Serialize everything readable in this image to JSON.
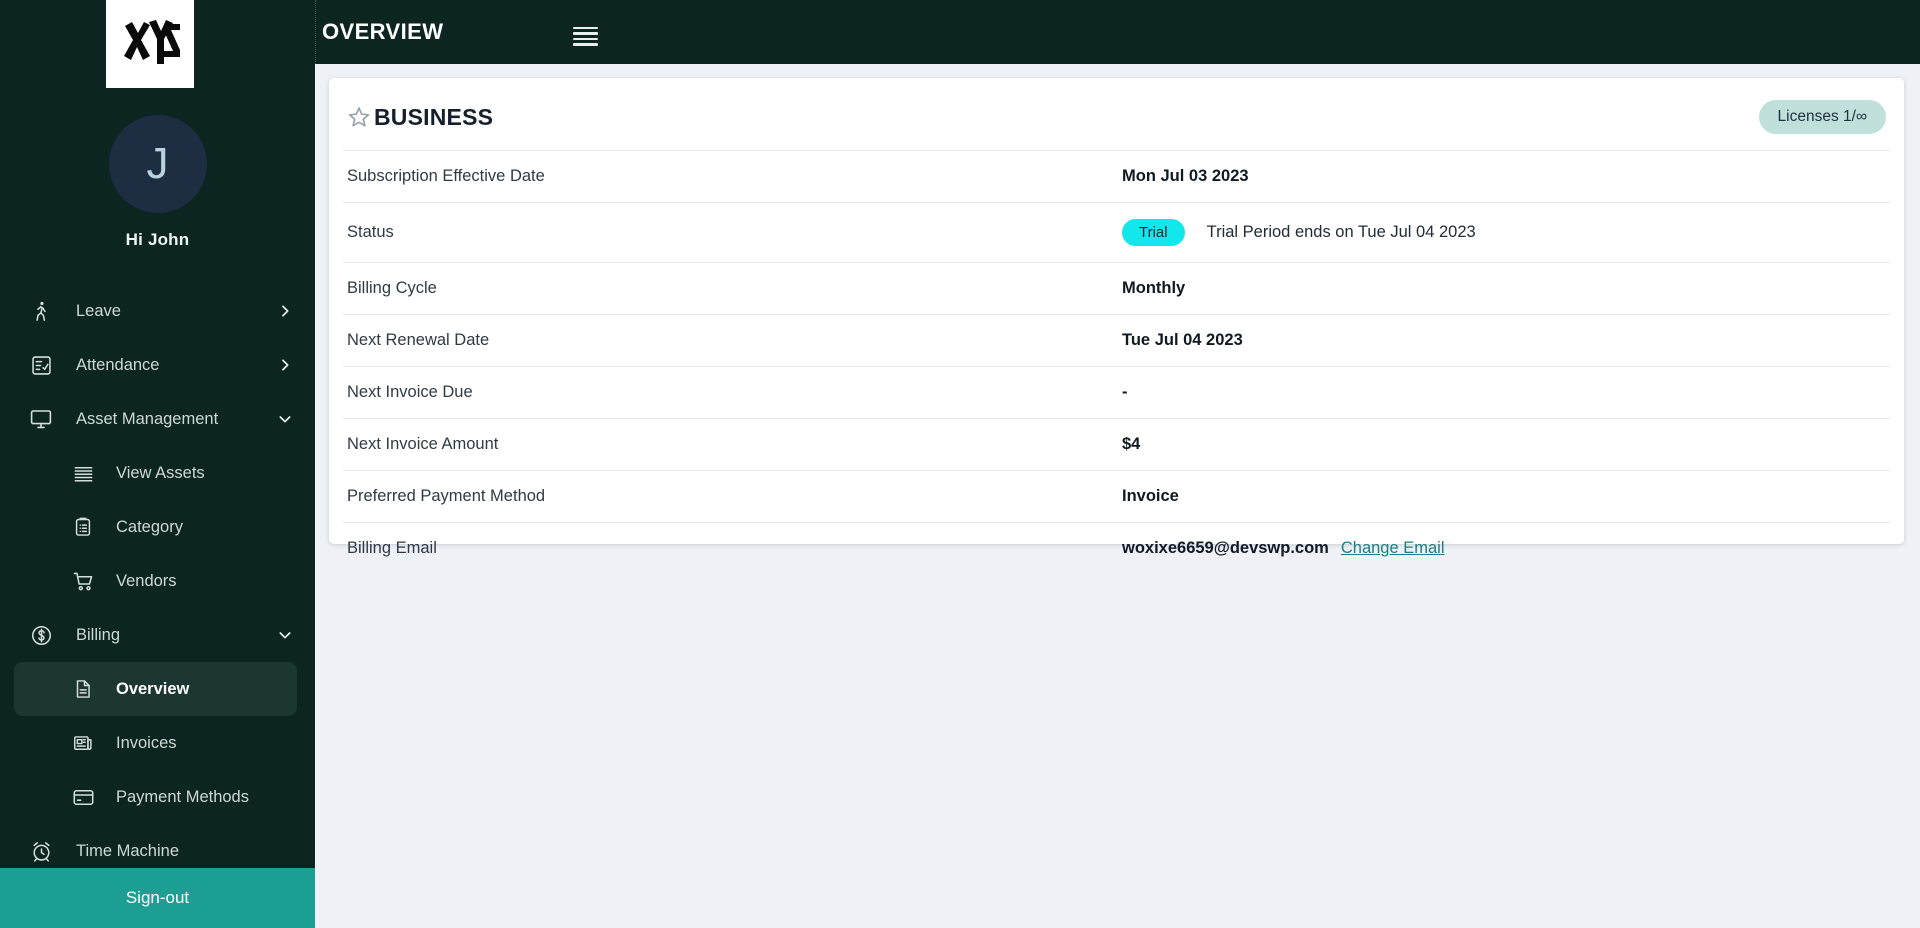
{
  "brand": {
    "logo_text": "XYZ"
  },
  "user": {
    "avatar_initial": "J",
    "greeting": "Hi John"
  },
  "header": {
    "title": "OVERVIEW",
    "menu_icon": "hamburger-icon"
  },
  "sidebar": {
    "items": [
      {
        "label": "Leave",
        "icon": "walking-person-icon",
        "chevron": "right",
        "level": 0,
        "active": false
      },
      {
        "label": "Attendance",
        "icon": "checklist-icon",
        "chevron": "right",
        "level": 0,
        "active": false
      },
      {
        "label": "Asset Management",
        "icon": "monitor-icon",
        "chevron": "down",
        "level": 0,
        "active": false
      },
      {
        "label": "View Assets",
        "icon": "list-lines-icon",
        "chevron": "",
        "level": 1,
        "active": false
      },
      {
        "label": "Category",
        "icon": "clipboard-icon",
        "chevron": "",
        "level": 1,
        "active": false
      },
      {
        "label": "Vendors",
        "icon": "shopping-cart-icon",
        "chevron": "",
        "level": 1,
        "active": false
      },
      {
        "label": "Billing",
        "icon": "dollar-circle-icon",
        "chevron": "down",
        "level": 0,
        "active": false
      },
      {
        "label": "Overview",
        "icon": "document-icon",
        "chevron": "",
        "level": 1,
        "active": true
      },
      {
        "label": "Invoices",
        "icon": "newspaper-icon",
        "chevron": "",
        "level": 1,
        "active": false
      },
      {
        "label": "Payment Methods",
        "icon": "credit-card-icon",
        "chevron": "",
        "level": 1,
        "active": false
      },
      {
        "label": "Time Machine",
        "icon": "alarm-clock-icon",
        "chevron": "",
        "level": 0,
        "active": false
      }
    ],
    "signout_label": "Sign-out"
  },
  "card": {
    "title": "BUSINESS",
    "title_icon": "star-icon",
    "licenses_badge": "Licenses 1/∞",
    "rows": [
      {
        "label": "Subscription Effective Date",
        "value": "Mon Jul 03 2023"
      },
      {
        "label": "Status",
        "value": "",
        "badge": "Trial",
        "note": "Trial Period ends on Tue Jul 04 2023"
      },
      {
        "label": "Billing Cycle",
        "value": "Monthly"
      },
      {
        "label": "Next Renewal Date",
        "value": "Tue Jul 04 2023"
      },
      {
        "label": "Next Invoice Due",
        "value": "-"
      },
      {
        "label": "Next Invoice Amount",
        "value": "$4"
      },
      {
        "label": "Preferred Payment Method",
        "value": "Invoice"
      },
      {
        "label": "Billing Email",
        "value": "woxixe6659@devswp.com",
        "link": "Change Email"
      }
    ]
  },
  "colors": {
    "sidebar_bg": "#0d2520",
    "sidebar_active": "#1c3731",
    "signout_bg": "#1d9e92",
    "page_bg": "#eef1f5",
    "trial_badge": "#12e8ec",
    "licenses_badge": "#bfe0db",
    "link": "#1d7f82"
  }
}
